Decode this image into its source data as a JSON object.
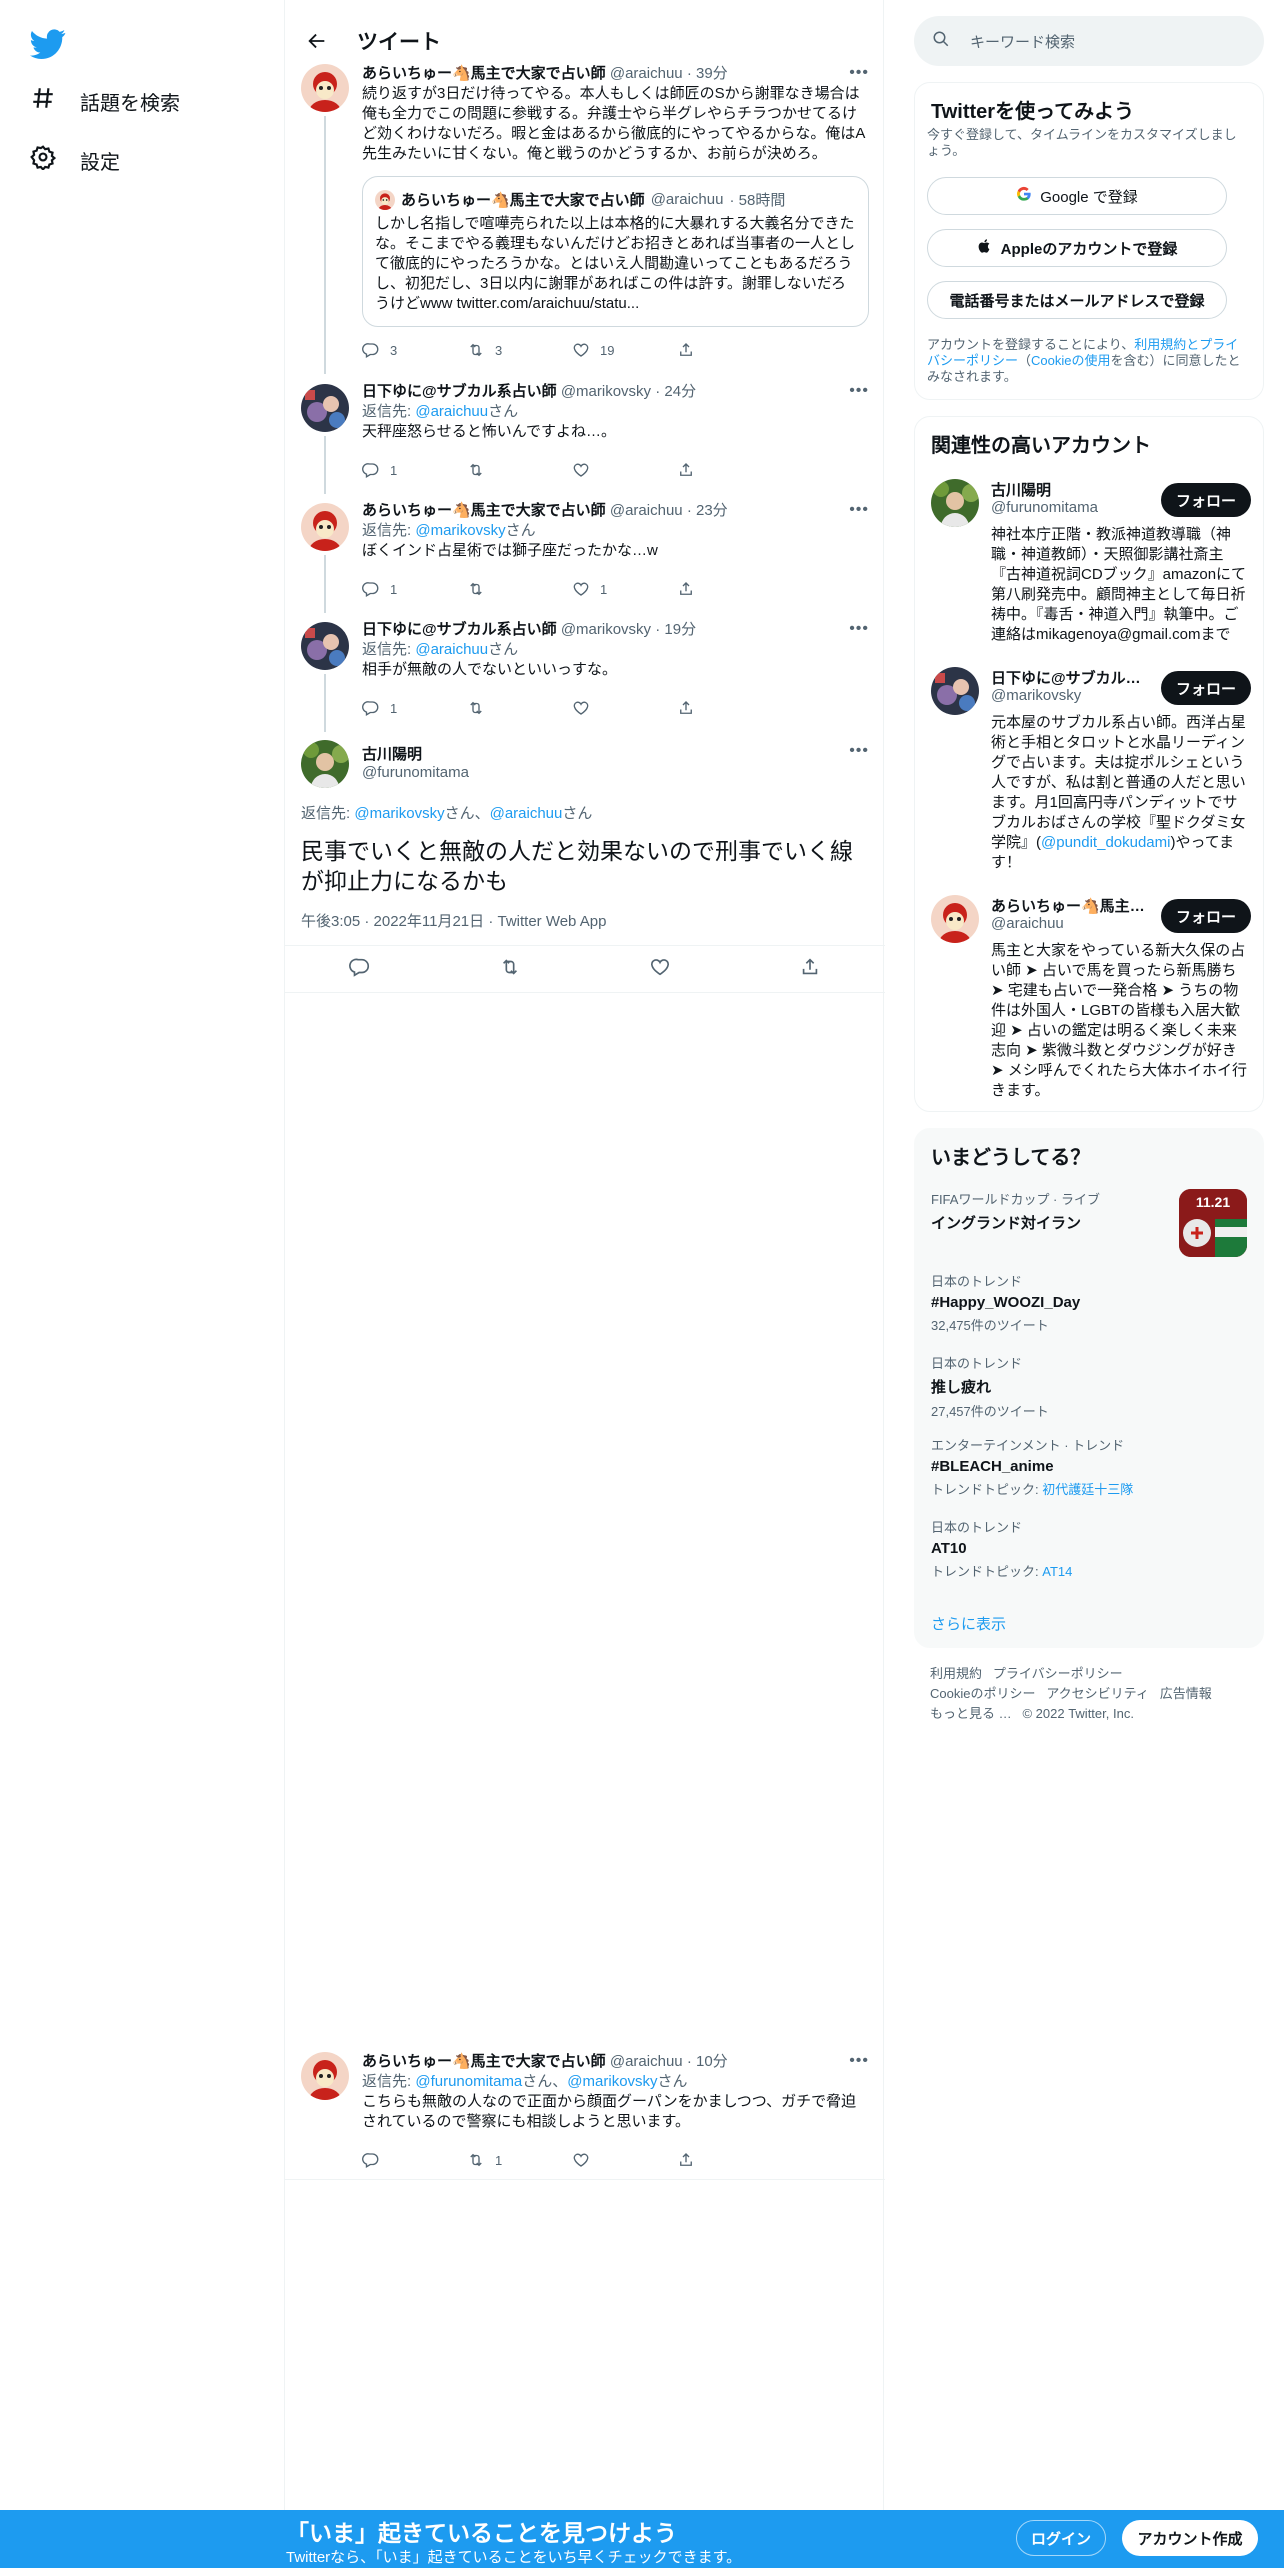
{
  "nav": {
    "explore_label": "話題を検索",
    "settings_label": "設定"
  },
  "header": {
    "title": "ツイート"
  },
  "tweets": [
    {
      "name": "あらいちゅー🐴馬主で大家で占い師",
      "handle": "@araichuu",
      "time": "· 39分",
      "text": "続り返すが3日だけ待ってやる。本人もしくは師匠のSから謝罪なき場合は俺も全力でこの問題に参戦する。弁護士やら半グレやらチラつかせてるけど効くわけないだろ。暇と金はあるから徹底的にやってやるからな。俺はA先生みたいに甘くない。俺と戦うのかどうするか、お前らが決めろ。",
      "quote": {
        "name": "あらいちゅー🐴馬主で大家で占い師",
        "handle": "@araichuu",
        "time": "· 58時間",
        "text": "しかし名指しで喧嘩売られた以上は本格的に大暴れする大義名分できたな。そこまでやる義理もないんだけどお招きとあれば当事者の一人として徹底的にやったろうかな。とはいえ人間勘違いってこともあるだろうし、初犯だし、3日以内に謝罪があればこの件は許す。謝罪しないだろうけどwww twitter.com/araichuu/statu..."
      },
      "replies": "3",
      "retweets": "3",
      "likes": "19"
    },
    {
      "name": "日下ゆに@サブカル系占い師",
      "handle": "@marikovsky",
      "time": "· 24分",
      "reply_prefix": "返信先: ",
      "reply_to": "@araichuu",
      "reply_suffix": "さん",
      "text": "天秤座怒らせると怖いんですよね…。",
      "replies": "1",
      "retweets": "",
      "likes": ""
    },
    {
      "name": "あらいちゅー🐴馬主で大家で占い師",
      "handle": "@araichuu",
      "time": "· 23分",
      "reply_prefix": "返信先: ",
      "reply_to": "@marikovsky",
      "reply_suffix": "さん",
      "text": "ぼくインド占星術では獅子座だったかな…w",
      "replies": "1",
      "retweets": "",
      "likes": "1"
    },
    {
      "name": "日下ゆに@サブカル系占い師",
      "handle": "@marikovsky",
      "time": "· 19分",
      "reply_prefix": "返信先: ",
      "reply_to": "@araichuu",
      "reply_suffix": "さん",
      "text": "相手が無敵の人でないといいっすな。",
      "replies": "1",
      "retweets": "",
      "likes": ""
    }
  ],
  "focus": {
    "name": "古川陽明",
    "handle": "@furunomitama",
    "reply_prefix": "返信先: ",
    "reply_to_1": "@marikovsky",
    "reply_mid": "さん、",
    "reply_to_2": "@araichuu",
    "reply_suffix": "さん",
    "text": "民事でいくと無敵の人だと効果ないので刑事でいく線が抑止力になるかも",
    "meta": "午後3:05 · 2022年11月21日 · Twitter Web App"
  },
  "last_tweet": {
    "name": "あらいちゅー🐴馬主で大家で占い師",
    "handle": "@araichuu",
    "time": "· 10分",
    "reply_prefix": "返信先: ",
    "reply_to_1": "@furunomitama",
    "reply_mid": "さん、",
    "reply_to_2": "@marikovsky",
    "reply_suffix": "さん",
    "text": "こちらも無敵の人なので正面から顔面グーパンをかましつつ、ガチで脅迫されているので警察にも相談しようと思います。",
    "replies": "",
    "retweets": "1",
    "likes": ""
  },
  "sidebar": {
    "search_placeholder": "キーワード検索",
    "signup": {
      "title": "Twitterを使ってみよう",
      "subtitle": "今すぐ登録して、タイムラインをカスタマイズしましょう。",
      "google": "Google で登録",
      "apple": "Appleのアカウントで登録",
      "phone": "電話番号またはメールアドレスで登録",
      "legal_1": "アカウントを登録することにより、",
      "legal_terms": "利用規約とプライバシーポリシー",
      "legal_2": "（",
      "legal_cookie": "Cookieの使用",
      "legal_3": "を含む）に同意したとみなされます。"
    },
    "related": {
      "title": "関連性の高いアカウント",
      "follow_label": "フォロー",
      "accounts": [
        {
          "name": "古川陽明",
          "handle": "@furunomitama",
          "bio": "神社本庁正階・教派神道教導職（神職・神道教師）・天照御影講社斎主『古神道祝詞CDブック』amazonにて第八刷発売中。顧問神主として毎日祈祷中。『毒舌・神道入門』執筆中。ご連絡はmikagenoya@gmail.comまで"
        },
        {
          "name": "日下ゆに@サブカル系占い師",
          "handle": "@marikovsky",
          "bio_1": "元本屋のサブカル系占い師。西洋占星術と手相とタロットと水晶リーディングで占います。夫は掟ポルシェという人ですが、私は割と普通の人だと思います。月1回高円寺パンディットでサブカルおばさんの学校『聖ドクダミ女学院』(",
          "bio_link": "@pundit_dokudami",
          "bio_2": ")やってます！"
        },
        {
          "name": "あらいちゅー🐴馬主で大家で占い師",
          "handle": "@araichuu",
          "bio": "馬主と大家をやっている新大久保の占い師 ➤ 占いで馬を買ったら新馬勝ち ➤ 宅建も占いで一発合格 ➤ うちの物件は外国人・LGBTの皆様も入居大歓迎 ➤ 占いの鑑定は明るく楽しく未来志向 ➤ 紫微斗数とダウジングが好き ➤ メシ呼んでくれたら大体ホイホイ行きます。"
        }
      ]
    },
    "trends": {
      "title": "いまどうしてる？",
      "items": [
        {
          "context": "FIFAワールドカップ · ライブ",
          "name": "イングランド対イラン",
          "count": "",
          "topic_prefix": "",
          "topic": ""
        },
        {
          "context": "日本のトレンド",
          "name": "#Happy_WOOZI_Day",
          "count": "32,475件のツイート",
          "topic_prefix": "",
          "topic": ""
        },
        {
          "context": "日本のトレンド",
          "name": "推し疲れ",
          "count": "27,457件のツイート",
          "topic_prefix": "",
          "topic": ""
        },
        {
          "context": "エンターテインメント · トレンド",
          "name": "#BLEACH_anime",
          "count": "",
          "topic_prefix": "トレンドトピック: ",
          "topic": "初代護廷十三隊"
        },
        {
          "context": "日本のトレンド",
          "name": "AT10",
          "count": "",
          "topic_prefix": "トレンドトピック: ",
          "topic": "AT14"
        }
      ],
      "show_more": "さらに表示",
      "image_text": "11.21"
    },
    "footer": {
      "terms": "利用規約",
      "privacy": "プライバシーポリシー",
      "cookie": "Cookieのポリシー",
      "accessibility": "アクセシビリティ",
      "ads": "広告情報",
      "more": "もっと見る …",
      "copyright": "© 2022 Twitter, Inc."
    }
  },
  "bottom_bar": {
    "title": "「いま」起きていることを見つけよう",
    "subtitle": "Twitterなら、「いま」起きていることをいち早くチェックできます。",
    "login": "ログイン",
    "signup": "アカウント作成"
  },
  "colors": {
    "accent": "#1d9bf0",
    "text": "#0f1419",
    "secondary": "#536471",
    "like_pink": "#f91880"
  },
  "icons": [
    "twitter-logo-icon",
    "hashtag-icon",
    "gear-icon",
    "back-arrow-icon",
    "reply-icon",
    "retweet-icon",
    "like-icon",
    "share-icon",
    "more-icon",
    "search-icon",
    "google-icon",
    "apple-icon"
  ]
}
